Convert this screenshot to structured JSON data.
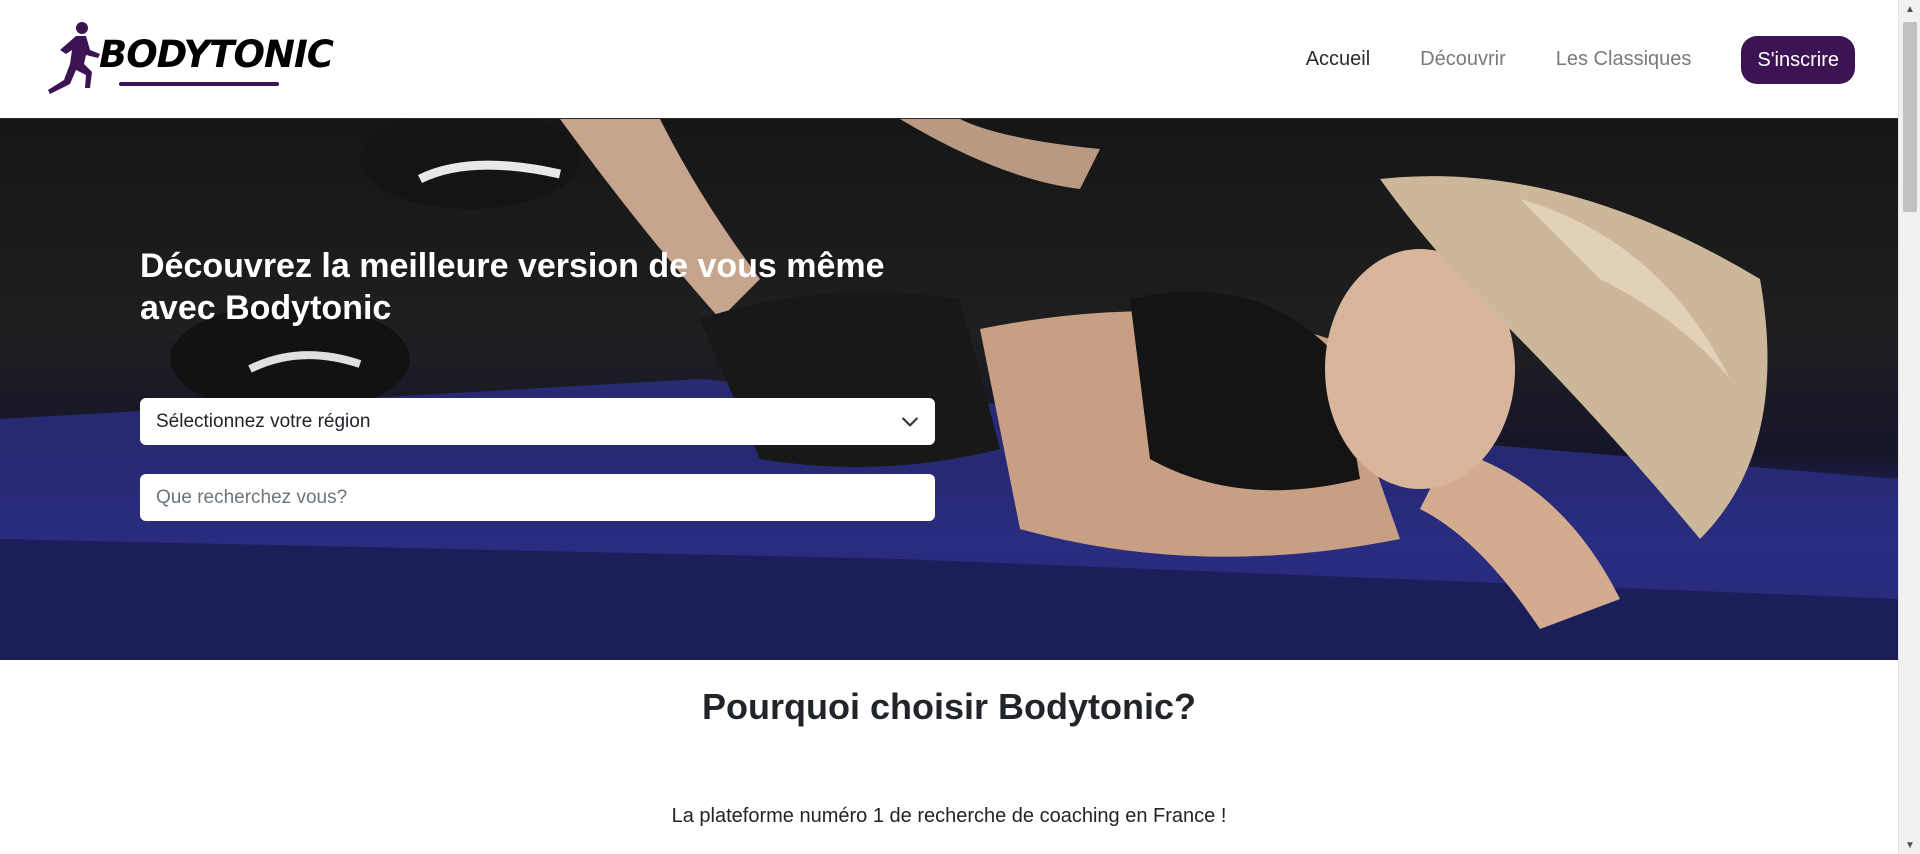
{
  "header": {
    "logo_text": "BODYTONIC",
    "nav": [
      {
        "label": "Accueil",
        "active": true
      },
      {
        "label": "Découvrir",
        "active": false
      },
      {
        "label": "Les Classiques",
        "active": false
      }
    ],
    "signup_label": "S'inscrire"
  },
  "hero": {
    "title": "Découvrez la meilleure version de vous même avec Bodytonic",
    "region_select": {
      "value": "Sélectionnez votre région"
    },
    "search": {
      "placeholder": "Que recherchez vous?"
    }
  },
  "why": {
    "title": "Pourquoi choisir Bodytonic?",
    "subtitle": "La plateforme numéro 1 de recherche de coaching en France !"
  },
  "colors": {
    "brand": "#3c1353",
    "mat_blue": "#282b7a"
  },
  "icons": {
    "logo": "runner-icon",
    "select": "chevron-down-icon",
    "scroll_up": "arrow-up-icon",
    "scroll_down": "arrow-down-icon"
  }
}
